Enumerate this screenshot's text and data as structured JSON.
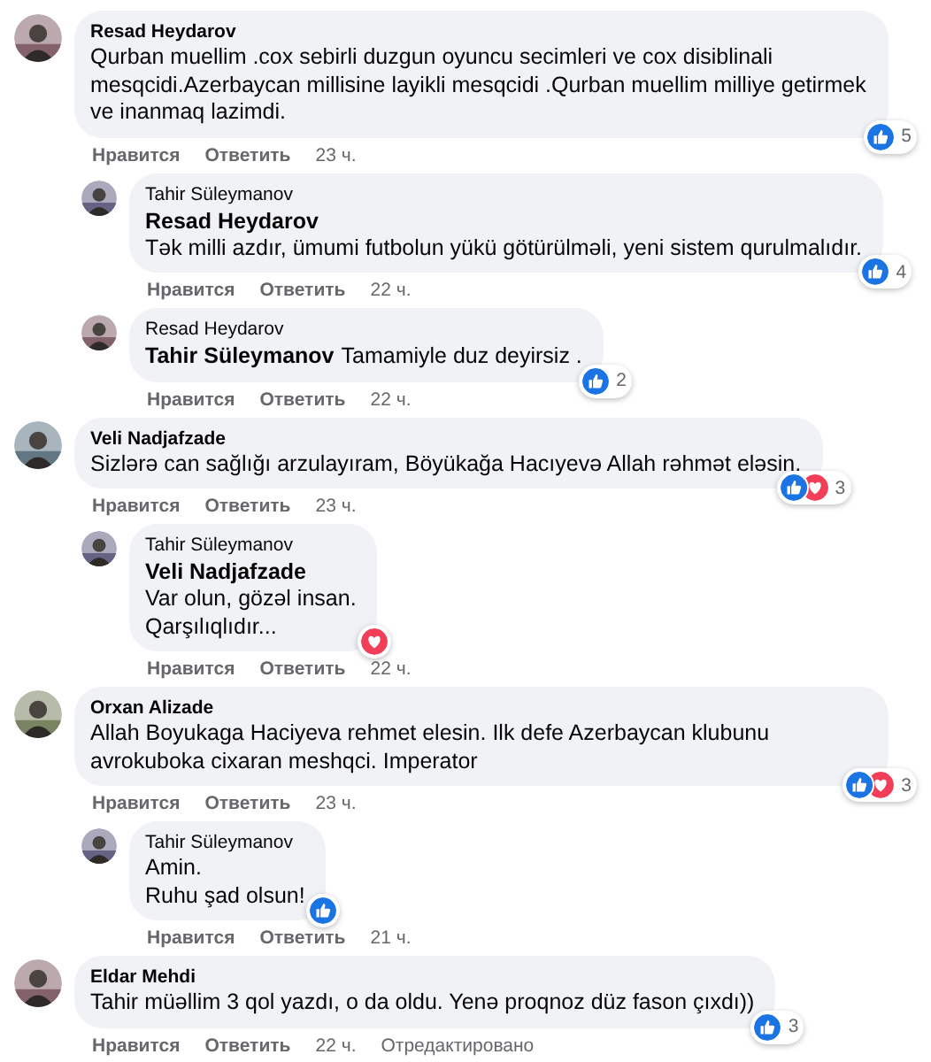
{
  "comments": [
    {
      "author": "Resad Heydarov",
      "paragraphs": [
        "Qurban muellim .cox sebirli duzgun oyuncu secimleri ve cox disiblinali mesqcidi.Azerbaycan millisine layikli mesqcidi .Qurban muellim milliye getirmek ve inanmaq lazimdi."
      ],
      "reactions": [
        {
          "kind": "like"
        }
      ],
      "count": "5",
      "like": "Нравится",
      "reply": "Ответить",
      "time": "23 ч.",
      "replies": [
        {
          "author": "Tahir Süleymanov",
          "mention": {
            "text": "Resad Heydarov",
            "kind": "block"
          },
          "paragraphs": [
            "Tək milli azdır, ümumi futbolun yükü götürülməli, yeni sistem qurulmalıdır."
          ],
          "reactions": [
            {
              "kind": "like"
            }
          ],
          "count": "4",
          "like": "Нравится",
          "reply": "Ответить",
          "time": "22 ч."
        },
        {
          "author": "Resad Heydarov",
          "mention": {
            "text": "Tahir Süleymanov",
            "kind": "inline"
          },
          "paragraphs": [
            "Tamamiyle duz deyirsiz ."
          ],
          "reactions": [
            {
              "kind": "like"
            }
          ],
          "count": "2",
          "like": "Нравится",
          "reply": "Ответить",
          "time": "22 ч."
        }
      ]
    },
    {
      "author": "Veli Nadjafzade",
      "paragraphs": [
        "Sizlərə can sağlığı arzulayıram, Böyükağa Hacıyevə Allah rəhmət eləsin."
      ],
      "reactions": [
        {
          "kind": "like"
        },
        {
          "kind": "love"
        }
      ],
      "count": "3",
      "like": "Нравится",
      "reply": "Ответить",
      "time": "23 ч.",
      "replies": [
        {
          "author": "Tahir Süleymanov",
          "mention": {
            "text": "Veli Nadjafzade",
            "kind": "block"
          },
          "paragraphs": [
            "Var olun, gözəl insan.",
            "Qarşılıqlıdır..."
          ],
          "reactions": [
            {
              "kind": "love"
            }
          ],
          "like": "Нравится",
          "reply": "Ответить",
          "time": "22 ч."
        }
      ]
    },
    {
      "author": "Orxan Alizade",
      "paragraphs": [
        "Allah Boyukaga Haciyeva rehmet elesin. Ilk defe Azerbaycan klubunu avrokuboka cixaran meshqci. Imperator"
      ],
      "reactions": [
        {
          "kind": "like"
        },
        {
          "kind": "love"
        }
      ],
      "count": "3",
      "like": "Нравится",
      "reply": "Ответить",
      "time": "23 ч.",
      "replies": [
        {
          "author": "Tahir Süleymanov",
          "paragraphs": [
            "Amin.",
            "Ruhu şad olsun!"
          ],
          "reactions": [
            {
              "kind": "like"
            }
          ],
          "like": "Нравится",
          "reply": "Ответить",
          "time": "21 ч."
        }
      ]
    },
    {
      "author": "Eldar Mehdi",
      "paragraphs": [
        "Tahir müəllim 3 qol yazdı, o da oldu. Yenə proqnoz düz fason çıxdı))"
      ],
      "reactions": [
        {
          "kind": "like"
        }
      ],
      "count": "3",
      "like": "Нравится",
      "reply": "Ответить",
      "time": "22 ч.",
      "edited": "Отредактировано"
    }
  ]
}
